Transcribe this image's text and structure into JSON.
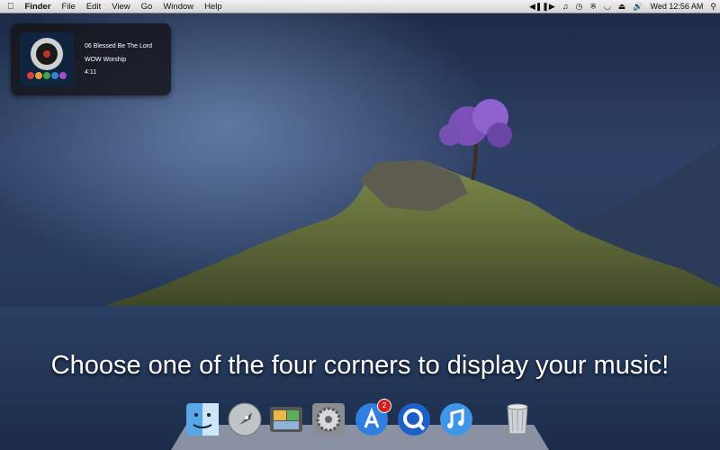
{
  "menubar": {
    "app_name": "Finder",
    "menus": [
      "File",
      "Edit",
      "View",
      "Go",
      "Window",
      "Help"
    ],
    "clock": "Wed 12:56 AM"
  },
  "now_playing": {
    "track": "06 Blessed Be The Lord",
    "artist": "WOW Worship",
    "duration": "4:11"
  },
  "caption": "Choose one of the four corners to display your music!",
  "dock": {
    "items": [
      {
        "icon": "finder-icon"
      },
      {
        "icon": "launchpad-icon"
      },
      {
        "icon": "photos-icon"
      },
      {
        "icon": "system-preferences-icon"
      },
      {
        "icon": "app-store-icon",
        "badge": "2"
      },
      {
        "icon": "quicktime-icon"
      },
      {
        "icon": "itunes-icon"
      },
      {
        "icon": "trash-icon"
      }
    ]
  }
}
